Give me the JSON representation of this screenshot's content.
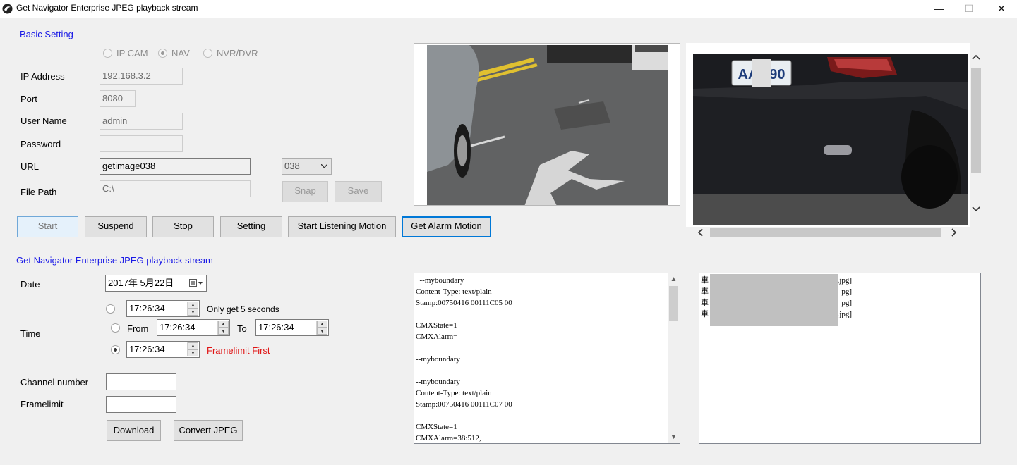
{
  "window": {
    "title": "Get Navigator Enterprise JPEG playback stream",
    "minimize": "—",
    "maximize": "☐",
    "close": "✕"
  },
  "basic": {
    "section_title": "Basic Setting",
    "modes": [
      "IP CAM",
      "NAV",
      "NVR/DVR"
    ],
    "labels": {
      "ip": "IP Address",
      "port": "Port",
      "user": "User Name",
      "password": "Password",
      "url": "URL",
      "file_path": "File Path"
    },
    "values": {
      "ip": "192.168.3.2",
      "port": "8080",
      "user": "admin",
      "password": "",
      "url": "getimage038",
      "file_path": "C:\\"
    },
    "url_select": "038",
    "snap": "Snap",
    "save": "Save"
  },
  "actions": {
    "start": "Start",
    "suspend": "Suspend",
    "stop": "Stop",
    "setting": "Setting",
    "start_listening": "Start Listening Motion",
    "get_alarm": "Get Alarm Motion"
  },
  "playback": {
    "section_title": "Get Navigator Enterprise JPEG playback stream",
    "date_label": "Date",
    "date_value": "2017年  5月22日",
    "time_label": "Time",
    "time1": "17:26:34",
    "only5": "Only get 5 seconds",
    "from_label": "From",
    "from_value": "17:26:34",
    "to_label": "To",
    "to_value": "17:26:34",
    "time3": "17:26:34",
    "framelimit_first": "Framelimit First",
    "channel_label": "Channel number",
    "framelimit_label": "Framelimit",
    "channel_value": "",
    "framelimit_value": "",
    "download": "Download",
    "convert": "Convert JPEG"
  },
  "log_lines": [
    "  --myboundary",
    "Content-Type: text/plain",
    "Stamp:00750416 00111C05 00",
    "",
    "CMXState=1",
    "CMXAlarm=",
    "",
    "--myboundary",
    "",
    "--myboundary",
    "Content-Type: text/plain",
    "Stamp:00750416 00111C07 00",
    "",
    "CMXState=1",
    "CMXAlarm=38:512,"
  ],
  "file_list": [
    {
      "pre": "車",
      "post": "1.jpg]"
    },
    {
      "pre": "車",
      "post": "pg]"
    },
    {
      "pre": "車",
      "post": "pg]"
    },
    {
      "pre": "車",
      "post": "0.jpg]"
    }
  ],
  "plate_text": "AA  990",
  "colors": {
    "section_blue": "#1a1ae6",
    "accent_focus": "#0078d7",
    "warning_red": "#e01414"
  }
}
